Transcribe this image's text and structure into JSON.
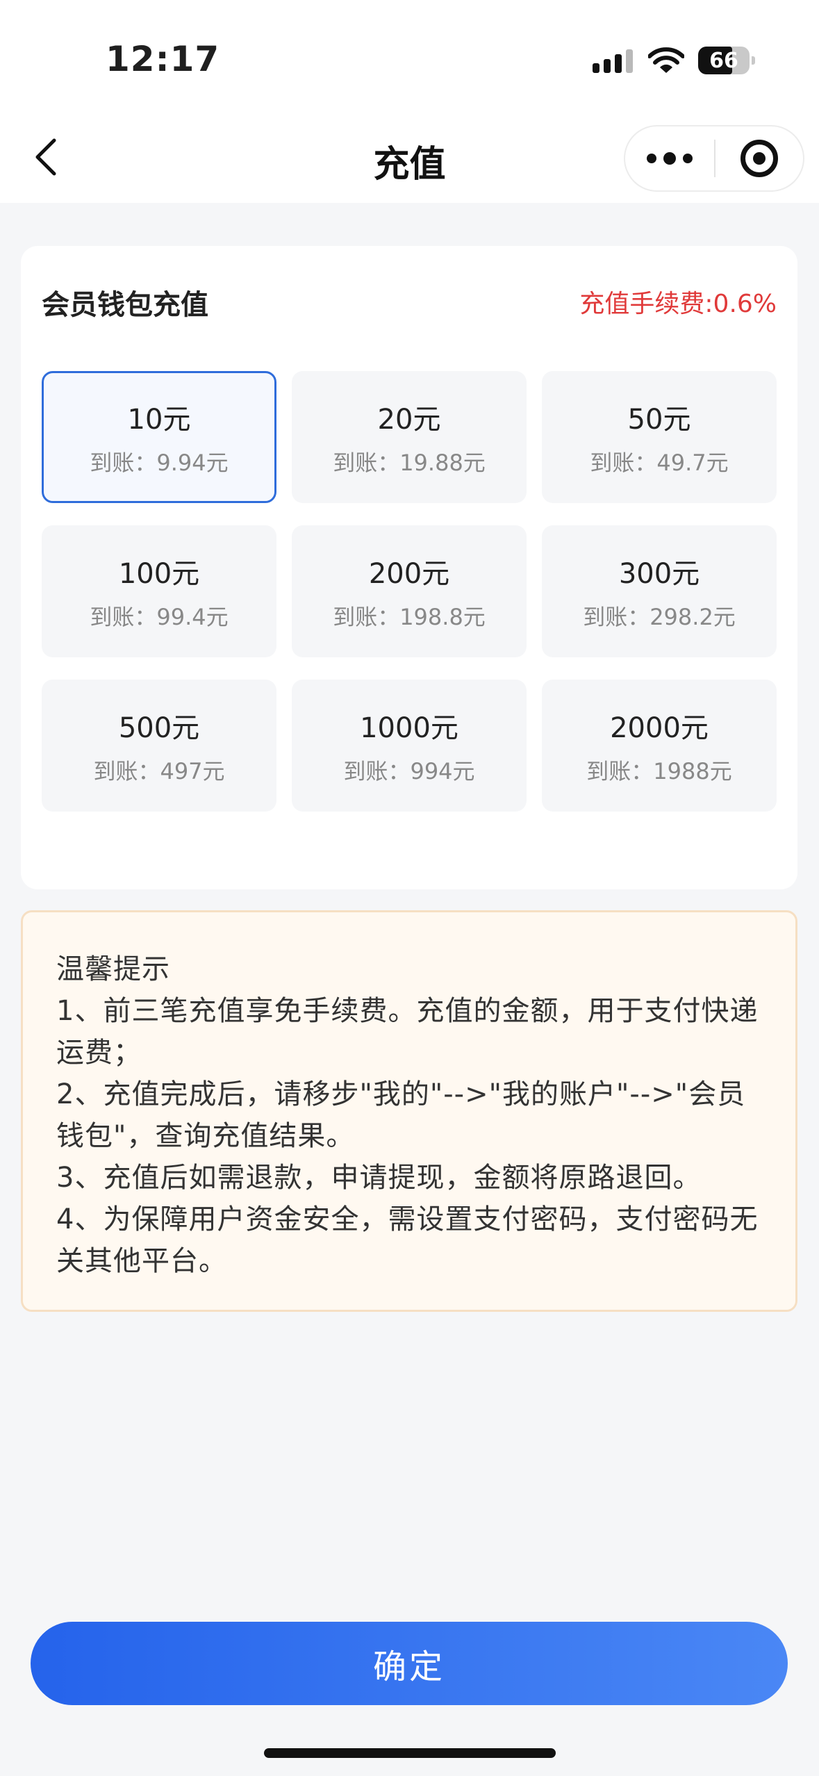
{
  "status_bar": {
    "time": "12:17",
    "battery": "66",
    "battery_level": 0.66
  },
  "nav": {
    "title": "充值",
    "back_icon": "chevron-left-icon",
    "more_icon": "more-dots-icon",
    "close_icon": "target-circle-icon"
  },
  "recharge": {
    "title": "会员钱包充值",
    "fee_text": "充值手续费:0.6%",
    "selected_index": 0,
    "options": [
      {
        "amount": "10元",
        "arrive": "到账：9.94元"
      },
      {
        "amount": "20元",
        "arrive": "到账：19.88元"
      },
      {
        "amount": "50元",
        "arrive": "到账：49.7元"
      },
      {
        "amount": "100元",
        "arrive": "到账：99.4元"
      },
      {
        "amount": "200元",
        "arrive": "到账：198.8元"
      },
      {
        "amount": "300元",
        "arrive": "到账：298.2元"
      },
      {
        "amount": "500元",
        "arrive": "到账：497元"
      },
      {
        "amount": "1000元",
        "arrive": "到账：994元"
      },
      {
        "amount": "2000元",
        "arrive": "到账：1988元"
      }
    ]
  },
  "tips": {
    "title": "温馨提示",
    "items": [
      "1、前三笔充值享免手续费。充值的金额，用于支付快递运费；",
      "2、充值完成后，请移步\"我的\"-->\"我的账户\"-->\"会员钱包\"，查询充值结果。",
      "3、充值后如需退款，申请提现，金额将原路退回。",
      "4、为保障用户资金安全，需设置支付密码，支付密码无关其他平台。"
    ]
  },
  "confirm_label": "确定",
  "colors": {
    "accent": "#2f6ddb",
    "fee_red": "#e03a3a",
    "tips_bg": "#fff9f1",
    "tips_border": "#f6dfc3"
  }
}
